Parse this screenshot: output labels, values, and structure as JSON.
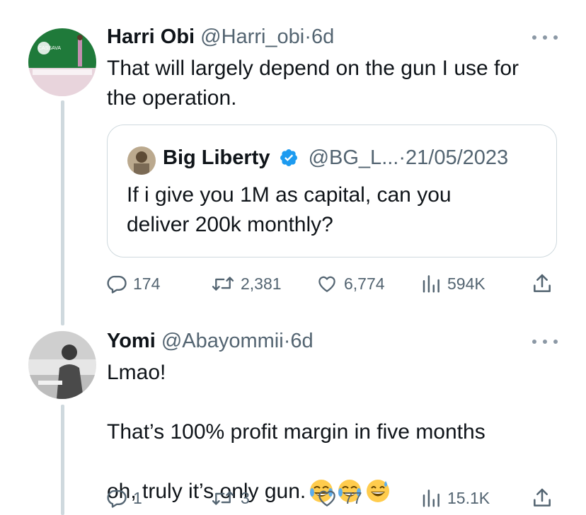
{
  "tweets": [
    {
      "name": "Harri Obi",
      "handle": "@Harri_obi",
      "dot": "·",
      "time": "6d",
      "text": "That will largely depend on the gun I use for\nthe operation.",
      "avatar_text": "CASSAVA",
      "quote": {
        "name": "Big Liberty",
        "handle": "@BG_L...",
        "dot": "·",
        "time": "21/05/2023",
        "text": "If i give you 1M as capital, can you\ndeliver 200k monthly?"
      },
      "actions": {
        "replies": "174",
        "retweets": "2,381",
        "likes": "6,774",
        "views": "594K"
      }
    },
    {
      "name": "Yomi",
      "handle": "@Abayommii",
      "dot": "·",
      "time": "6d",
      "text_line1": "Lmao!",
      "text_line2": "That’s 100% profit margin in five months",
      "text_line3": "oh, truly it’s only gun.",
      "emojis": [
        "face-with-tears-of-joy",
        "face-with-tears-of-joy",
        "grinning-face-with-sweat"
      ],
      "actions": {
        "replies": "1",
        "retweets": "3",
        "likes": "77",
        "views": "15.1K"
      }
    }
  ],
  "colors": {
    "text": "#0f1419",
    "secondary": "#536471",
    "verified": "#1d9bf0",
    "border": "#cfd9de"
  }
}
